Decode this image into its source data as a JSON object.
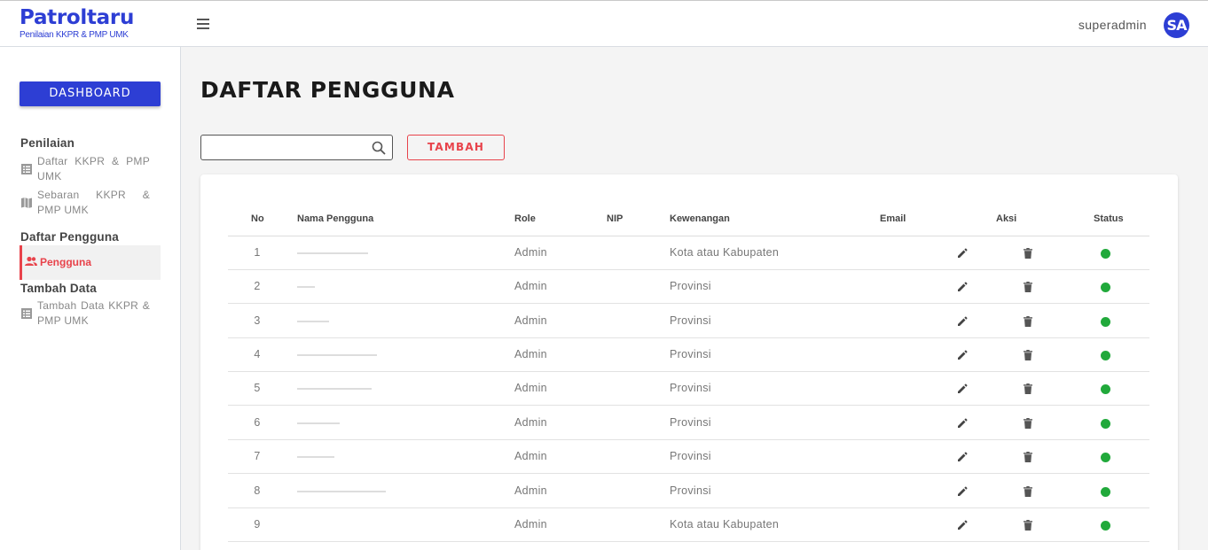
{
  "brand": {
    "title": "Patroltaru",
    "subtitle": "Penilaian KKPR & PMP UMK"
  },
  "header": {
    "username": "superadmin",
    "avatar_initials": "SA"
  },
  "sidebar": {
    "dashboard_label": "DASHBOARD",
    "sections": [
      {
        "title": "Penilaian",
        "items": [
          {
            "label": "Daftar KKPR & PMP UMK",
            "icon": "list-icon"
          },
          {
            "label": "Sebaran KKPR & PMP UMK",
            "icon": "map-icon"
          }
        ]
      },
      {
        "title": "Daftar Pengguna",
        "items": [
          {
            "label": "Pengguna",
            "icon": "users-icon",
            "active": true
          }
        ]
      },
      {
        "title": "Tambah Data",
        "items": [
          {
            "label": "Tambah Data KKPR & PMP UMK",
            "icon": "list-icon"
          }
        ]
      }
    ]
  },
  "main": {
    "title": "DAFTAR PENGGUNA",
    "search": {
      "value": "",
      "placeholder": ""
    },
    "add_label": "TAMBAH",
    "table": {
      "headers": [
        "No",
        "Nama Pengguna",
        "Role",
        "NIP",
        "Kewenangan",
        "Email",
        "Aksi",
        "Status"
      ],
      "rows": [
        {
          "no": "1",
          "role": "Admin",
          "kewenangan": "Kota atau Kabupaten",
          "status": "active"
        },
        {
          "no": "2",
          "role": "Admin",
          "kewenangan": "Provinsi",
          "status": "active"
        },
        {
          "no": "3",
          "role": "Admin",
          "kewenangan": "Provinsi",
          "status": "active"
        },
        {
          "no": "4",
          "role": "Admin",
          "kewenangan": "Provinsi",
          "status": "active"
        },
        {
          "no": "5",
          "role": "Admin",
          "kewenangan": "Provinsi",
          "status": "active"
        },
        {
          "no": "6",
          "role": "Admin",
          "kewenangan": "Provinsi",
          "status": "active"
        },
        {
          "no": "7",
          "role": "Admin",
          "kewenangan": "Provinsi",
          "status": "active"
        },
        {
          "no": "8",
          "role": "Admin",
          "kewenangan": "Provinsi",
          "status": "active"
        },
        {
          "no": "9",
          "role": "Admin",
          "kewenangan": "Kota atau Kabupaten",
          "status": "active"
        }
      ]
    }
  },
  "colors": {
    "brand": "#2d3ed4",
    "accent": "#e8434b",
    "status_active": "#21a93b"
  }
}
